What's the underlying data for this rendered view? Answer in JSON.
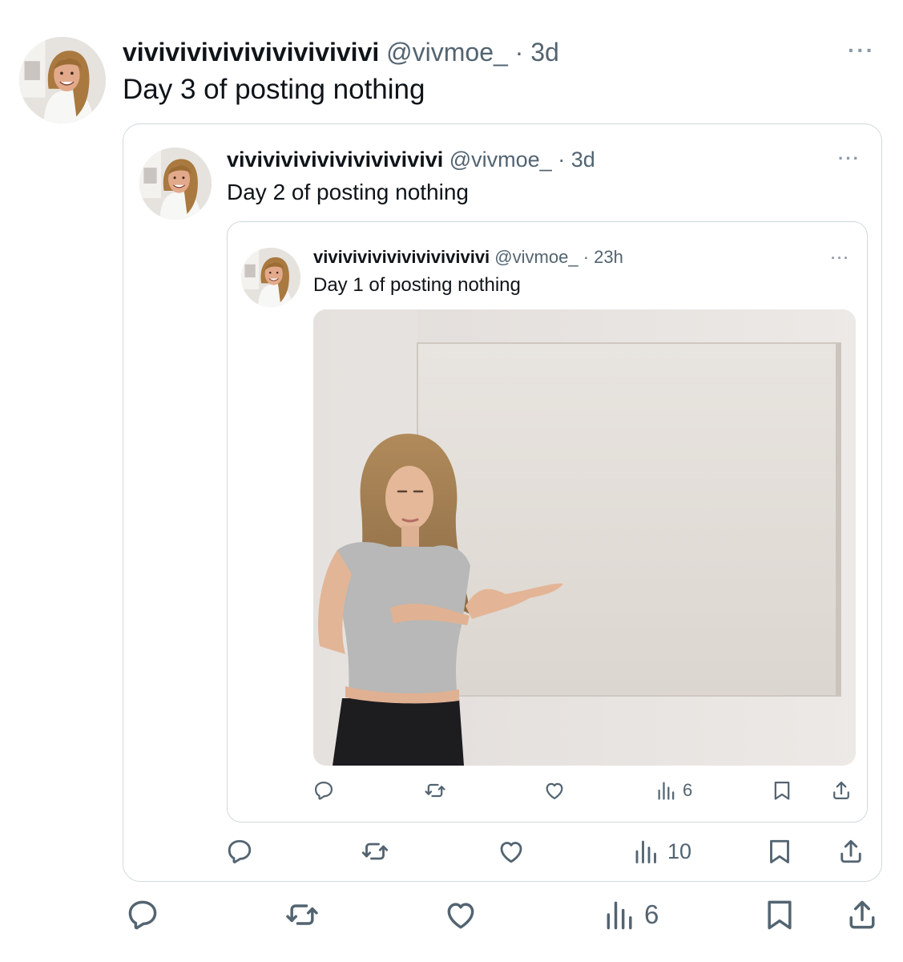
{
  "outer": {
    "name": "vivivivivivivivivivivivi",
    "handle": "@vivmoe_",
    "sep": "·",
    "time": "3d",
    "text": "Day 3 of posting nothing",
    "views": "6",
    "more": "···"
  },
  "mid": {
    "name": "vivivivivivivivivivivivi",
    "handle": "@vivmoe_",
    "sep": "·",
    "time": "3d",
    "text": "Day 2 of posting nothing",
    "views": "10",
    "more": "···"
  },
  "inner": {
    "name": "vivivivivivivivivivivivi",
    "handle": "@vivmoe_",
    "sep": "·",
    "time": "23h",
    "text": "Day 1 of posting nothing",
    "views": "6",
    "more": "···"
  },
  "icons": {
    "reply": "reply-icon",
    "repost": "repost-icon",
    "like": "like-icon",
    "views": "views-icon",
    "bookmark": "bookmark-icon",
    "share": "share-icon"
  },
  "colors": {
    "text": "#0f1419",
    "muted": "#536471",
    "border": "#cfd9de"
  }
}
